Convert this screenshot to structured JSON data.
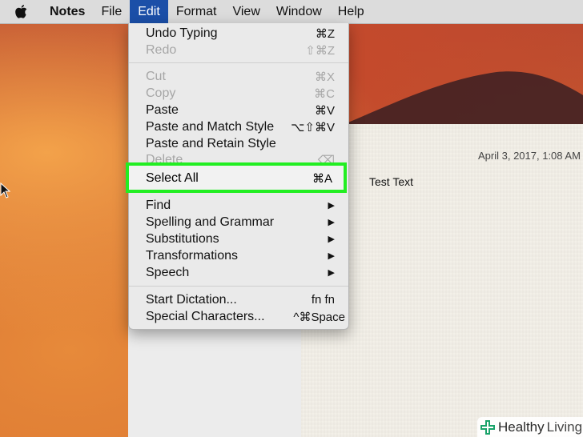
{
  "menubar": {
    "apple_icon": "apple-logo",
    "items": [
      {
        "label": "Notes",
        "bold": true
      },
      {
        "label": "File"
      },
      {
        "label": "Edit",
        "active": true
      },
      {
        "label": "Format"
      },
      {
        "label": "View"
      },
      {
        "label": "Window"
      },
      {
        "label": "Help"
      }
    ]
  },
  "edit_menu": {
    "items": [
      {
        "label": "Undo Typing",
        "shortcut": "⌘Z",
        "enabled": true
      },
      {
        "label": "Redo",
        "shortcut": "⇧⌘Z",
        "enabled": false
      },
      {
        "label": "Cut",
        "shortcut": "⌘X",
        "enabled": false
      },
      {
        "label": "Copy",
        "shortcut": "⌘C",
        "enabled": false
      },
      {
        "label": "Paste",
        "shortcut": "⌘V",
        "enabled": true
      },
      {
        "label": "Paste and Match Style",
        "shortcut": "⌥⇧⌘V",
        "enabled": true
      },
      {
        "label": "Paste and Retain Style",
        "shortcut": "",
        "enabled": true
      },
      {
        "label": "Delete",
        "shortcut": "⌫",
        "enabled": false
      },
      {
        "label": "Select All",
        "shortcut": "⌘A",
        "enabled": true,
        "highlighted": true
      },
      {
        "label": "Find",
        "submenu": true
      },
      {
        "label": "Spelling and Grammar",
        "submenu": true
      },
      {
        "label": "Substitutions",
        "submenu": true
      },
      {
        "label": "Transformations",
        "submenu": true
      },
      {
        "label": "Speech",
        "submenu": true
      },
      {
        "label": "Start Dictation...",
        "shortcut": "fn fn",
        "enabled": true
      },
      {
        "label": "Special Characters...",
        "shortcut": "^⌘Space",
        "enabled": true
      }
    ],
    "submenu_arrow": "▶",
    "highlight_color": "#22ee22"
  },
  "note": {
    "date": "April 3, 2017, 1:08 AM",
    "text": "Test Text"
  },
  "watermark": {
    "brand_bold": "Healthy",
    "brand_light": "Living",
    "icon": "plus-cross-icon",
    "color": "#1aa36a"
  }
}
